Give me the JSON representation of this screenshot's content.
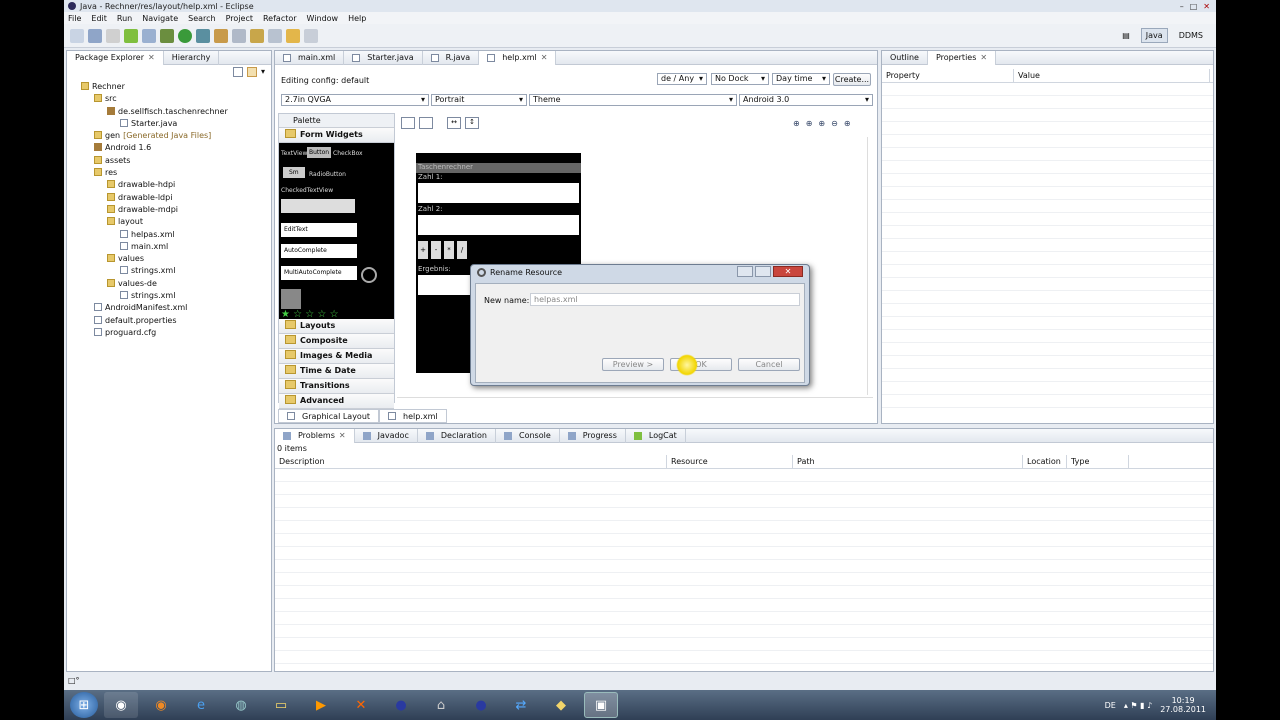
{
  "window": {
    "title": "Java - Rechner/res/layout/help.xml - Eclipse"
  },
  "menu": [
    "File",
    "Edit",
    "Run",
    "Navigate",
    "Search",
    "Project",
    "Refactor",
    "Window",
    "Help"
  ],
  "perspectives": {
    "java": "Java",
    "ddms": "DDMS"
  },
  "package_explorer": {
    "tabs": [
      "Package Explorer",
      "Hierarchy"
    ],
    "tree": [
      {
        "label": "Rechner",
        "depth": 0,
        "icon": "project-icon"
      },
      {
        "label": "src",
        "depth": 1,
        "icon": "folder-icon"
      },
      {
        "label": "de.sellfisch.taschenrechner",
        "depth": 2,
        "icon": "package-icon"
      },
      {
        "label": "Starter.java",
        "depth": 3,
        "icon": "java-file-icon"
      },
      {
        "label": "gen",
        "depth": 1,
        "icon": "folder-icon",
        "extra": "[Generated Java Files]"
      },
      {
        "label": "Android 1.6",
        "depth": 1,
        "icon": "library-icon"
      },
      {
        "label": "assets",
        "depth": 1,
        "icon": "folder-icon"
      },
      {
        "label": "res",
        "depth": 1,
        "icon": "folder-icon"
      },
      {
        "label": "drawable-hdpi",
        "depth": 2,
        "icon": "folder-icon"
      },
      {
        "label": "drawable-ldpi",
        "depth": 2,
        "icon": "folder-icon"
      },
      {
        "label": "drawable-mdpi",
        "depth": 2,
        "icon": "folder-icon"
      },
      {
        "label": "layout",
        "depth": 2,
        "icon": "folder-icon"
      },
      {
        "label": "helpas.xml",
        "depth": 3,
        "icon": "xml-file-icon"
      },
      {
        "label": "main.xml",
        "depth": 3,
        "icon": "xml-file-icon"
      },
      {
        "label": "values",
        "depth": 2,
        "icon": "folder-icon"
      },
      {
        "label": "strings.xml",
        "depth": 3,
        "icon": "xml-file-icon"
      },
      {
        "label": "values-de",
        "depth": 2,
        "icon": "folder-icon"
      },
      {
        "label": "strings.xml",
        "depth": 3,
        "icon": "xml-file-icon"
      },
      {
        "label": "AndroidManifest.xml",
        "depth": 1,
        "icon": "xml-file-icon"
      },
      {
        "label": "default.properties",
        "depth": 1,
        "icon": "file-icon"
      },
      {
        "label": "proguard.cfg",
        "depth": 1,
        "icon": "file-icon"
      }
    ]
  },
  "editor": {
    "tabs": [
      "main.xml",
      "Starter.java",
      "R.java",
      "help.xml"
    ],
    "config_label": "Editing config: default",
    "locale": "de / Any",
    "dock": "No Dock",
    "time": "Day time",
    "create": "Create...",
    "screen": "2.7in QVGA",
    "orientation": "Portrait",
    "theme": "Theme",
    "target": "Android 3.0",
    "bottom_tabs": [
      "Graphical Layout",
      "help.xml"
    ]
  },
  "palette": {
    "title": "Palette",
    "open_category": "Form Widgets",
    "categories": [
      "Layouts",
      "Composite",
      "Images & Media",
      "Time & Date",
      "Transitions",
      "Advanced"
    ],
    "widgets": {
      "textview": "TextView",
      "button": "Button",
      "checkbox": "CheckBox",
      "small": "Sm",
      "radio": "RadioButton",
      "checked": "CheckedTextView",
      "edittext": "EditText",
      "autocomplete": "AutoComplete",
      "multiauto": "MultiAutoComplete"
    }
  },
  "phone": {
    "app_title": "Taschenrechner",
    "zahl1": "Zahl 1:",
    "zahl2": "Zahl 2:",
    "ops": [
      "+",
      "-",
      "*",
      "/"
    ],
    "ergebnis": "Ergebnis:"
  },
  "properties": {
    "tabs": [
      "Outline",
      "Properties"
    ],
    "columns": [
      "Property",
      "Value"
    ]
  },
  "bottom": {
    "tabs": [
      "Problems",
      "Javadoc",
      "Declaration",
      "Console",
      "Progress",
      "LogCat"
    ],
    "count": "0 items",
    "columns": [
      "Description",
      "Resource",
      "Path",
      "Location",
      "Type"
    ]
  },
  "dialog": {
    "title": "Rename Resource",
    "label": "New name:",
    "value": "helpas.xml",
    "preview": "Preview >",
    "ok": "OK",
    "cancel": "Cancel"
  },
  "status": {
    "left": "□°"
  },
  "clock": {
    "time": "10:19",
    "date": "27.08.2011",
    "lang": "DE"
  }
}
